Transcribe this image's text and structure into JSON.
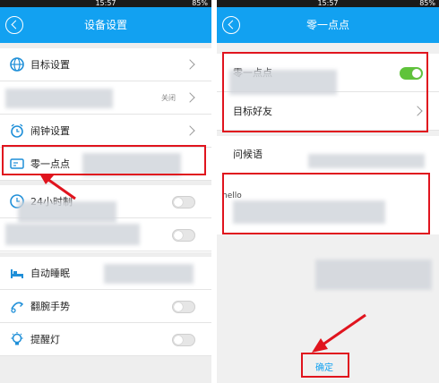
{
  "left": {
    "status_time": "15:57",
    "status_battery": "85%",
    "title": "设备设置",
    "items": [
      {
        "label": "目标设置"
      },
      {
        "label": "",
        "value": "关闭"
      },
      {
        "label": "闹钟设置"
      },
      {
        "label": "零一点点"
      },
      {
        "label": "24小时制"
      },
      {
        "label": ""
      },
      {
        "label": "自动睡眠"
      },
      {
        "label": "翻腕手势"
      },
      {
        "label": "提醒灯"
      }
    ]
  },
  "right": {
    "status_time": "15:57",
    "status_battery": "85%",
    "title": "零一点点",
    "toggle_label": "零一点点",
    "toggle_on": true,
    "friend_label": "目标好友",
    "greeting_label": "问候语",
    "greeting_text": "hello",
    "confirm_label": "确定"
  },
  "colors": {
    "title_bar": "#12a1f1",
    "highlight": "#e0141e",
    "toggle_on": "#5fc33a"
  }
}
